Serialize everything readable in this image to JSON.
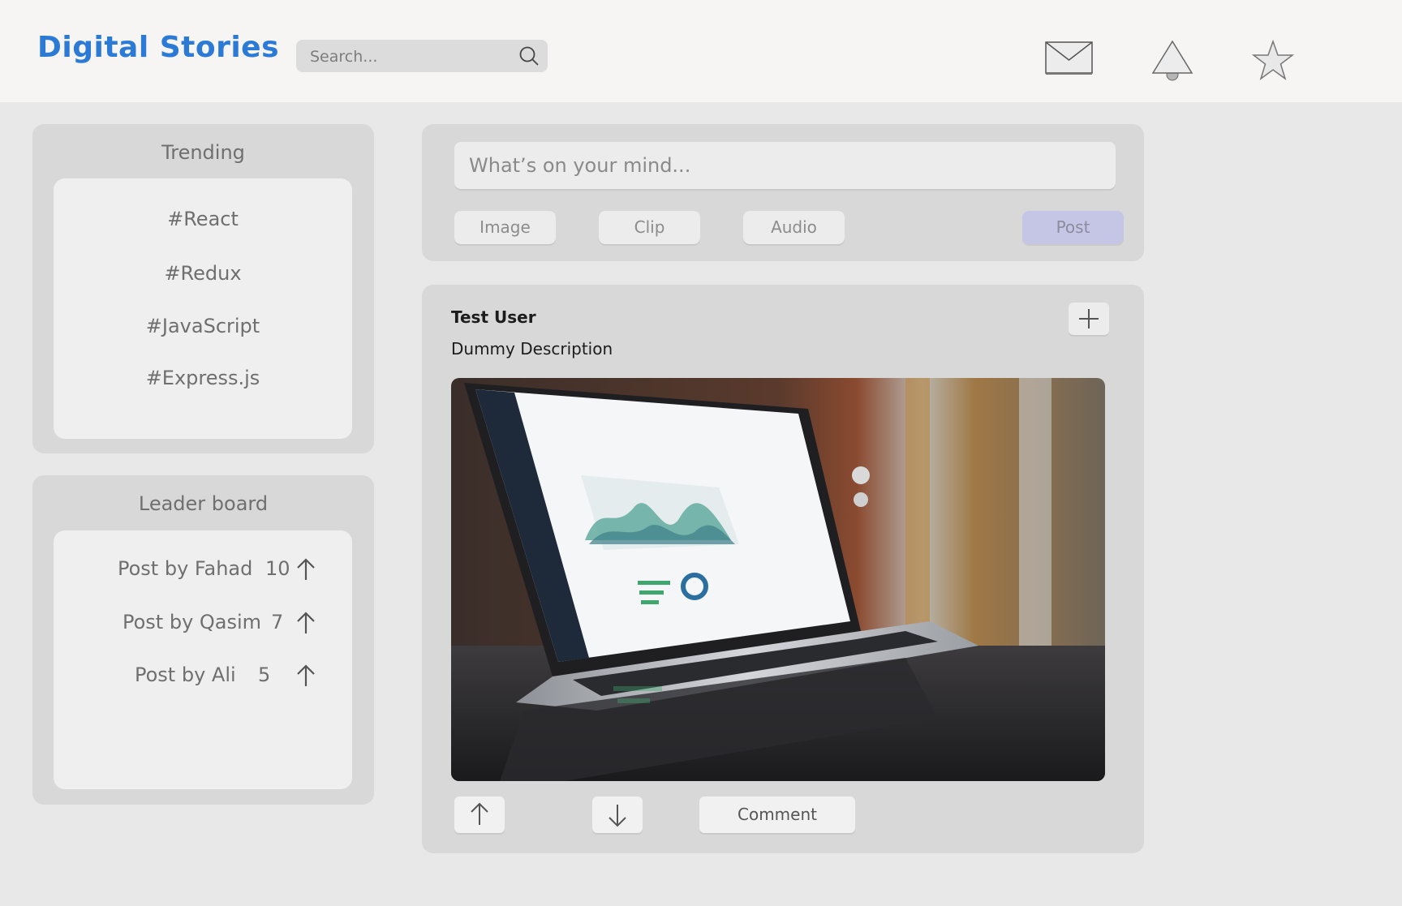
{
  "header": {
    "brand": "Digital Stories",
    "search_placeholder": "Search...",
    "icons": [
      "mail-icon",
      "bell-icon",
      "star-icon"
    ]
  },
  "trending": {
    "title": "Trending",
    "tags": [
      "#React",
      "#Redux",
      "#JavaScript",
      "#Express.js"
    ]
  },
  "leaderboard": {
    "title": "Leader board",
    "rows": [
      {
        "name": "Post by Fahad",
        "count": "10"
      },
      {
        "name": "Post by Qasim",
        "count": "7"
      },
      {
        "name": "Post by Ali",
        "count": "5"
      }
    ]
  },
  "composer": {
    "placeholder": "What’s on your mind...",
    "buttons": [
      "Image",
      "Clip",
      "Audio"
    ],
    "post_label": "Post"
  },
  "feed_post": {
    "user": "Test User",
    "description": "Dummy Description",
    "comment_label": "Comment"
  },
  "colors": {
    "brand": "#2b7bd6",
    "post_button": "#c5c6e6",
    "background": "#e8e8e8"
  }
}
